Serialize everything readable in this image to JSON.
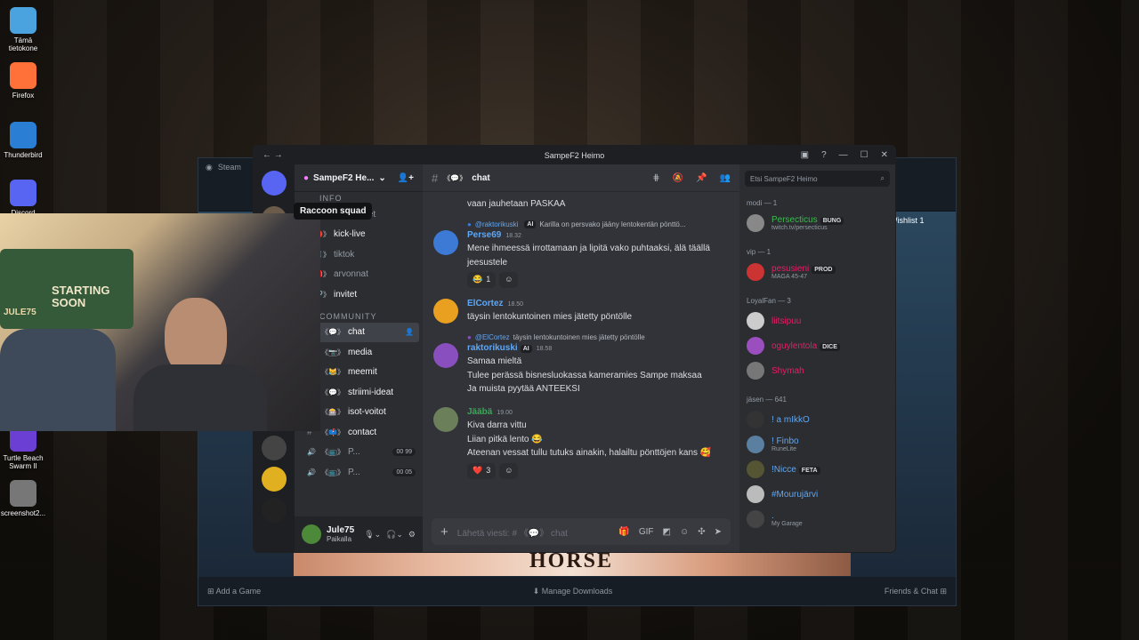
{
  "desktop": [
    {
      "label": "Tämä tietokone",
      "color": "#4aa3df"
    },
    {
      "label": "Firefox",
      "color": "#ff7139"
    },
    {
      "label": "Thunderbird",
      "color": "#2a7fd4"
    },
    {
      "label": "Discord",
      "color": "#5865f2"
    },
    {
      "label": "Turtle Beach Swarm II",
      "color": "#6b3fd4"
    },
    {
      "label": "screenshot2...",
      "color": "#777"
    }
  ],
  "steam": {
    "menu": "Steam",
    "wishlist": "Wishlist",
    "wishlist_count": "1",
    "add_game": "Add a Game",
    "downloads": "Manage Downloads",
    "friends": "Friends & Chat"
  },
  "webcam": {
    "sign": "STARTING SOON",
    "name_tag": "JULE75"
  },
  "tooltip": "Raccoon squad",
  "discord": {
    "title": "SampeF2 Heimo",
    "server_name": "SampeF2 He...",
    "channels_top": [
      {
        "label": "ilmoitukset",
        "emoji": "📢",
        "bright": false
      },
      {
        "label": "kick-live",
        "emoji": "🔴",
        "bright": true
      },
      {
        "label": "tiktok",
        "emoji": "🎵",
        "bright": false
      },
      {
        "label": "arvonnat",
        "emoji": "🎁",
        "bright": false
      },
      {
        "label": "invitet",
        "emoji": "🔗",
        "bright": true
      }
    ],
    "category_info": "INFO",
    "category_community": "COMMUNITY",
    "channels_community": [
      {
        "label": "chat",
        "emoji": "💬"
      },
      {
        "label": "media",
        "emoji": "📷"
      },
      {
        "label": "meemit",
        "emoji": "😹"
      },
      {
        "label": "striimi-ideat",
        "emoji": "💬"
      },
      {
        "label": "isot-voitot",
        "emoji": "🎰"
      },
      {
        "label": "contact",
        "emoji": "📫"
      }
    ],
    "voice": [
      {
        "label": "P...",
        "badge": "00 99"
      },
      {
        "label": "P...",
        "badge": "00 05"
      }
    ],
    "user": {
      "name": "Jule75",
      "status": "Paikalla"
    },
    "channel": "chat",
    "messages": [
      {
        "cont": true,
        "text": "vaan jauhetaan PASKAA"
      },
      {
        "reply_to": "@raktorikuski",
        "reply_tag": "AI",
        "reply_text": "Karilla on persvako jääny lentokentän pönttö...",
        "name": "Perse69",
        "color": "#5fa7f5",
        "time": "18.32",
        "lines": [
          "Mene ihmeessä irrottamaan ja lipitä vako puhtaaksi, älä täällä jeesustele"
        ],
        "reactions": [
          {
            "emoji": "😂",
            "count": "1"
          }
        ],
        "avatar": "#3c7ad6"
      },
      {
        "name": "ElCortez",
        "color": "#5fa7f5",
        "time": "18.50",
        "lines": [
          "täysin lentokuntoinen mies  jätetty pöntölle"
        ],
        "avatar": "#e9a020"
      },
      {
        "reply_to": "@ElCortez",
        "reply_text": "täysin lentokuntoinen mies  jätetty pöntölle",
        "name": "raktorikuski",
        "tag": "AI",
        "color": "#5fa7f5",
        "time": "18.58",
        "lines": [
          "Samaa mieltä",
          "Tulee perässä bisnesluokassa kameramies Sampe maksaa",
          "Ja muista pyytää ANTEEKSI"
        ],
        "avatar": "#8a4fbf"
      },
      {
        "name": "Jääbä",
        "color": "#3fa45a",
        "time": "19.00",
        "lines": [
          "Kiva darra vittu",
          "Liian pitkä lento 😂",
          "Ateenan vessat tullu tutuks ainakin, halailtu pönttöjen kans 🥰"
        ],
        "reactions": [
          {
            "emoji": "❤️",
            "count": "3"
          }
        ],
        "avatar": "#6b7f5a"
      }
    ],
    "input_placeholder": "Lähetä viesti: # 《💬》 chat",
    "search_placeholder": "Etsi SampeF2 Heimo",
    "member_groups": [
      {
        "title": "modi — 1",
        "members": [
          {
            "name": "Persecticus",
            "tag": "BUNG",
            "sub": "twitch.tv/persecticus",
            "color": "#3fb950"
          }
        ]
      },
      {
        "title": "vip — 1",
        "members": [
          {
            "name": "pesusieni",
            "tag": "PROD",
            "sub": "MAGA 45-47",
            "color": "#e91e63"
          }
        ]
      },
      {
        "title": "LoyalFan — 3",
        "members": [
          {
            "name": "liitsipuu",
            "color": "#e91e63"
          },
          {
            "name": "oguylentola",
            "tag": "DICE",
            "color": "#e91e63"
          },
          {
            "name": "Shymah",
            "color": "#e91e63"
          }
        ]
      },
      {
        "title": "jäsen — 641",
        "members": [
          {
            "name": "! a mIkkO",
            "color": "#5fa7f5"
          },
          {
            "name": "! Finbo",
            "sub": "RuneLite",
            "color": "#5fa7f5"
          },
          {
            "name": "!Nicce",
            "tag": "FETA",
            "color": "#5fa7f5"
          },
          {
            "name": "#Mourujärvi",
            "color": "#5fa7f5"
          },
          {
            "name": ".",
            "sub": "My Garage",
            "color": "#5fa7f5"
          }
        ]
      }
    ]
  }
}
